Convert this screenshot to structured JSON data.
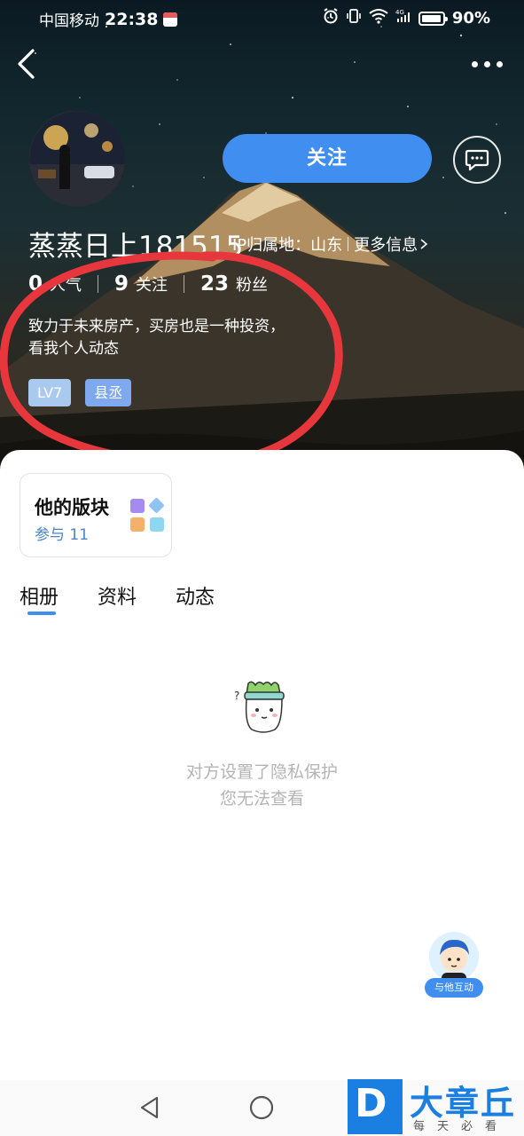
{
  "status_bar": {
    "carrier": "中国移动",
    "time": "22:38",
    "battery": "90%",
    "network": "4G"
  },
  "profile": {
    "username": "蒸蒸日上181515",
    "ip_location": "IP归属地：山东",
    "more_info": "更多信息",
    "follow_label": "关注",
    "stats": [
      {
        "value": "0",
        "label": "人气"
      },
      {
        "value": "9",
        "label": "关注"
      },
      {
        "value": "23",
        "label": "粉丝"
      }
    ],
    "bio_line1": "致力于未来房产，买房也是一种投资，",
    "bio_line2": "看我个人动态",
    "tags": [
      "LV7",
      "县丞"
    ]
  },
  "board_card": {
    "title": "他的版块",
    "subtitle": "参与 11"
  },
  "tabs": [
    {
      "label": "相册",
      "active": true
    },
    {
      "label": "资料",
      "active": false
    },
    {
      "label": "动态",
      "active": false
    }
  ],
  "empty_state": {
    "line1": "对方设置了隐私保护",
    "line2": "您无法查看"
  },
  "interact_button": {
    "label": "与他互动"
  },
  "watermark": {
    "letter": "D",
    "main": "大章丘",
    "sub": "每天必看"
  },
  "colors": {
    "accent": "#3f8ef0",
    "annotation": "#e8363d"
  }
}
